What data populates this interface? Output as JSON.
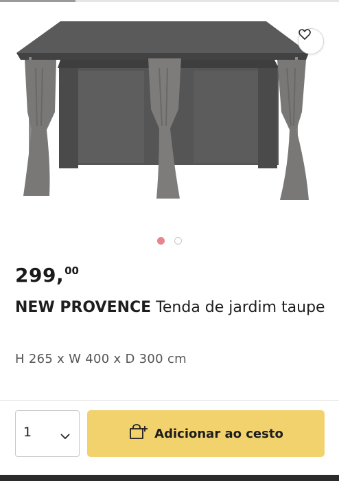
{
  "product": {
    "price_integer": "299,",
    "price_decimal": "00",
    "brand": "NEW PROVENCE",
    "name": " Tenda de jardim taupe",
    "dimensions": "H 265 x W 400 x D 300 cm"
  },
  "gallery": {
    "image_count": 2,
    "active_index": 0
  },
  "cart": {
    "quantity": "1",
    "add_label": "Adicionar ao cesto"
  },
  "colors": {
    "accent_button": "#f2d26d",
    "active_dot": "#e8858c"
  },
  "icons": {
    "wishlist": "heart-icon",
    "quantity": "chevron-down-icon",
    "add": "shopping-bag-plus-icon"
  }
}
